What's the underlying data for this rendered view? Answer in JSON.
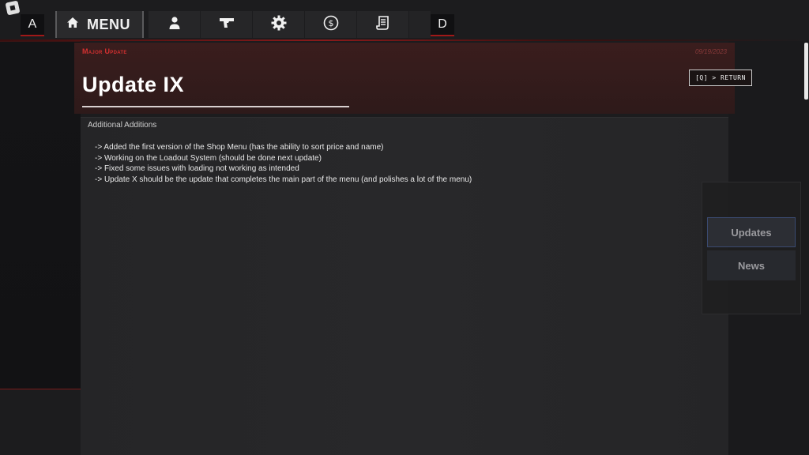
{
  "nav": {
    "left_key": "A",
    "right_key": "D",
    "menu_label": "MENU",
    "icons": [
      "home-icon",
      "person-icon",
      "pistol-icon",
      "gear-icon",
      "dollar-coin-icon",
      "scroll-icon"
    ]
  },
  "header": {
    "tag": "Major Update",
    "date": "09/19/2023",
    "title": "Update IX",
    "return_label": "[Q] > RETURN"
  },
  "content": {
    "section_title": "Additional Additions",
    "items": [
      "-> Added the first version of the Shop Menu (has the ability to sort price and name)",
      "-> Working on the Loadout System (should be done next update)",
      "-> Fixed some issues with loading not working as intended",
      "-> Update X should be the update that completes the main part of the menu (and polishes a lot of the menu)"
    ]
  },
  "side_tabs": {
    "updates": "Updates",
    "news": "News"
  },
  "colors": {
    "accent_red": "#a01818",
    "header_bg": "#3a1d1d",
    "tag_red": "#d43030"
  }
}
